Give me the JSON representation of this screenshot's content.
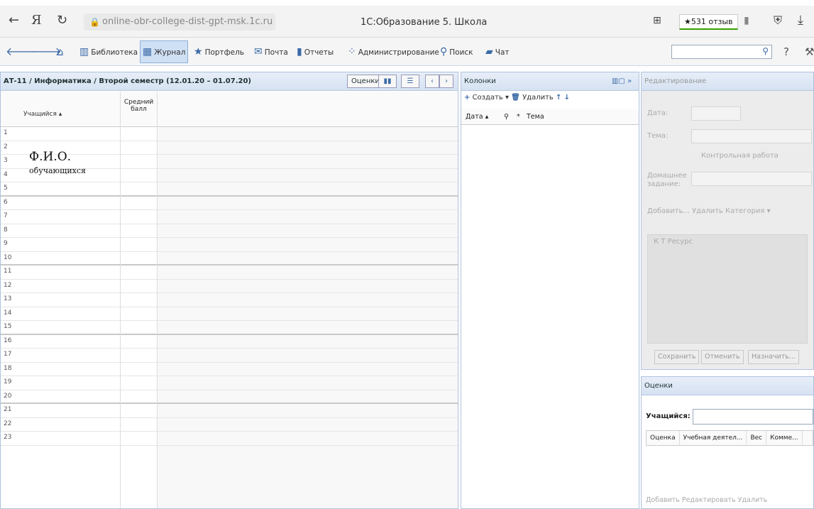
{
  "browser": {
    "url": "online-obr-college-dist-gpt-msk.1c.ru",
    "title": "1С:Образование 5. Школа",
    "reviews": "★531 отзыв"
  },
  "appbar": {
    "items": [
      "Библиотека",
      "Журнал",
      "Портфель",
      "Почта",
      "Отчеты",
      "Администрирование",
      "Поиск",
      "Чат"
    ],
    "active": "Журнал"
  },
  "journal": {
    "title": "АТ-11 / Информатика / Второй семестр (12.01.20 – 01.07.20)",
    "grades_button": "Оценки",
    "col_student": "Учащийся ▴",
    "col_avg": "Средний балл",
    "student_name_line1": "Ф.И.О.",
    "student_name_line2": "обучающихся",
    "row_numbers": [
      "1",
      "2",
      "3",
      "4",
      "5",
      "6",
      "7",
      "8",
      "9",
      "10",
      "11",
      "12",
      "13",
      "14",
      "15",
      "16",
      "17",
      "18",
      "19",
      "20",
      "21",
      "22",
      "23"
    ]
  },
  "columns_panel": {
    "title": "Колонки",
    "create": "Создать",
    "delete": "Удалить",
    "col_date": "Дата ▴",
    "col_topic": "Тема"
  },
  "edit_panel": {
    "title": "Редактирование",
    "date_label": "Дата:",
    "topic_label": "Тема:",
    "control_work": "Контрольная работа",
    "homework_label": "Домашнее задание:",
    "add": "Добавить...",
    "delete": "Удалить",
    "category": "Категория ▾",
    "res_cols": "К Т Ресурс",
    "save": "Сохранить",
    "cancel": "Отменить",
    "assign": "Назначить..."
  },
  "grades_panel": {
    "title": "Оценки",
    "student_label": "Учащийся:",
    "cols": [
      "Оценка",
      "Учебная деятел...",
      "Вес",
      "Комме..."
    ],
    "add": "Добавить",
    "edit": "Редактировать",
    "delete": "Удалить"
  }
}
